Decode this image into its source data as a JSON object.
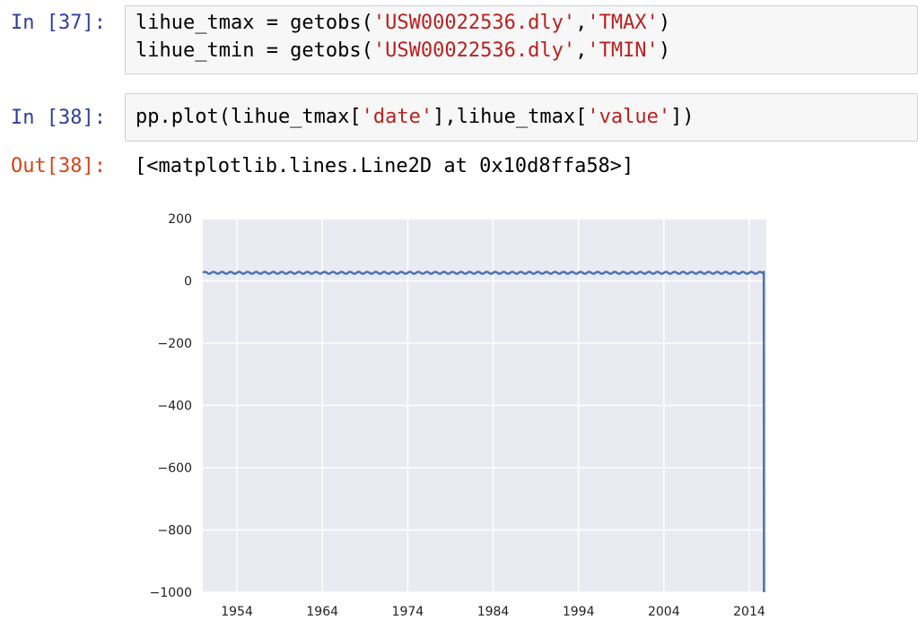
{
  "cells": [
    {
      "prompt": "In [37]:",
      "lines": [
        {
          "pre": "lihue_tmax = getobs(",
          "s1": "'USW00022536.dly'",
          "mid": ",",
          "s2": "'TMAX'",
          "post": ")"
        },
        {
          "pre": "lihue_tmin = getobs(",
          "s1": "'USW00022536.dly'",
          "mid": ",",
          "s2": "'TMIN'",
          "post": ")"
        }
      ]
    },
    {
      "prompt": "In [38]:",
      "line": {
        "pre": "pp.plot(lihue_tmax[",
        "s1": "'date'",
        "mid": "],lihue_tmax[",
        "s2": "'value'",
        "post": "])"
      },
      "out_prompt": "Out[38]:",
      "out_text": "[<matplotlib.lines.Line2D at 0x10d8ffa58>]"
    }
  ],
  "colors": {
    "in_prompt": "#303f9f",
    "out_prompt": "#d84315",
    "string": "#ba2121",
    "line": "#4c72b0",
    "plot_bg": "#eaeaf2",
    "grid": "#ffffff"
  },
  "chart_data": {
    "type": "line",
    "title": "",
    "xlabel": "",
    "ylabel": "",
    "x_ticks": [
      "1954",
      "1964",
      "1974",
      "1984",
      "1994",
      "2004",
      "2014"
    ],
    "y_ticks": [
      200,
      0,
      -200,
      -400,
      -600,
      -800,
      -1000
    ],
    "xlim": [
      1950,
      2016
    ],
    "ylim": [
      -1000,
      200
    ],
    "grid": true,
    "series": [
      {
        "description_points": [
          [
            1950.0,
            25
          ],
          [
            1950.5,
            28
          ],
          [
            1951.0,
            24
          ],
          [
            1951.5,
            28
          ],
          [
            1952.0,
            24
          ],
          [
            2015.0,
            26
          ],
          [
            2015.5,
            28
          ],
          [
            2015.7,
            28
          ],
          [
            2015.72,
            -1000
          ]
        ],
        "band": {
          "min": 23,
          "max": 29
        }
      }
    ]
  }
}
